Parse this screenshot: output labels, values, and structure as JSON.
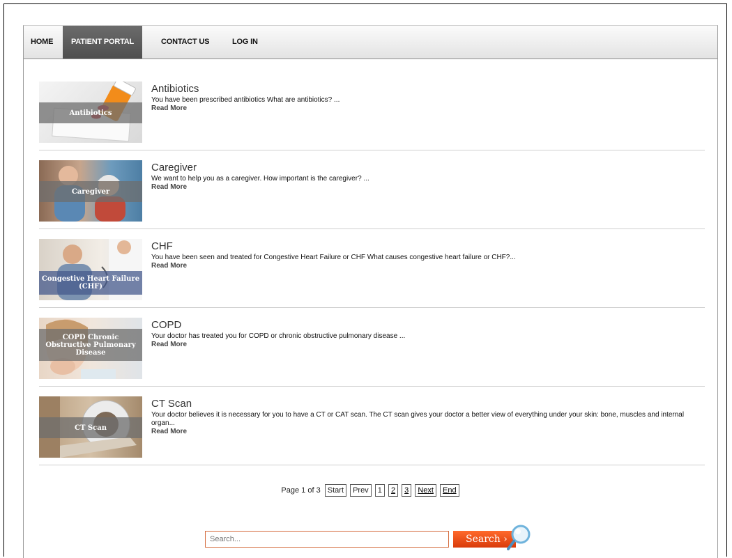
{
  "nav": {
    "items": [
      {
        "label": "HOME"
      },
      {
        "label": "PATIENT PORTAL"
      },
      {
        "label": "CONTACT US"
      },
      {
        "label": "LOG IN"
      }
    ]
  },
  "articles": [
    {
      "title": "Antibiotics",
      "desc": "You have been prescribed antibiotics What are antibiotics? ...",
      "more": "Read More",
      "thumb_label": "Antibiotics"
    },
    {
      "title": "Caregiver",
      "desc": "We want to help you as a caregiver. How important is the caregiver? ...",
      "more": "Read More",
      "thumb_label": "Caregiver"
    },
    {
      "title": "CHF",
      "desc": "You have been seen and treated for Congestive Heart Failure or CHF What causes congestive heart failure or CHF?...",
      "more": "Read More",
      "thumb_label": "Congestive Heart Failure (CHF)"
    },
    {
      "title": "COPD",
      "desc": "Your doctor has treated you for COPD or chronic obstructive pulmonary disease ...",
      "more": "Read More",
      "thumb_label": "COPD Chronic Obstructive Pulmonary Disease"
    },
    {
      "title": "CT Scan",
      "desc": "Your doctor believes it is necessary for you to have a CT or CAT scan. The CT scan gives your doctor a better view of everything under your skin: bone, muscles and internal organ...",
      "more": "Read More",
      "thumb_label": "CT Scan"
    }
  ],
  "pager": {
    "label": "Page 1 of 3",
    "start": "Start",
    "prev": "Prev",
    "p1": "1",
    "p2": "2",
    "p3": "3",
    "next": "Next",
    "end": "End"
  },
  "search": {
    "placeholder": "Search...",
    "button": "Search ›"
  },
  "colors": {
    "accent": "#e84a12",
    "nav_active": "#555555"
  }
}
